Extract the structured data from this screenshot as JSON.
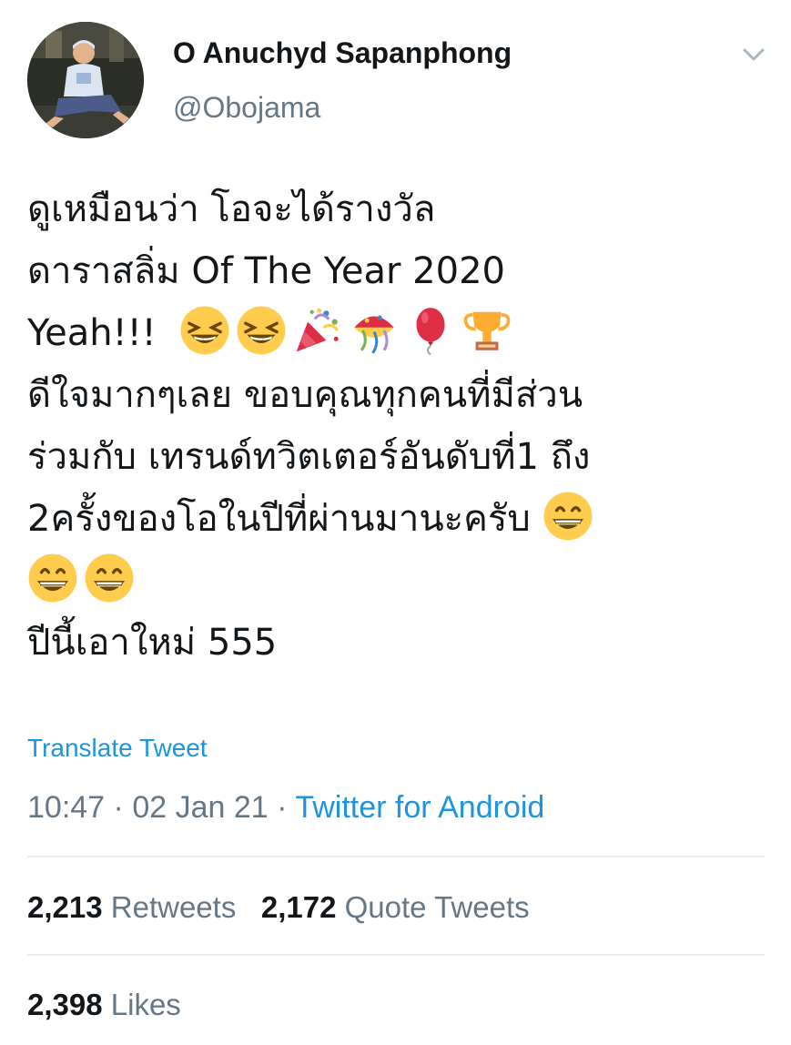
{
  "user": {
    "display_name": "O Anuchyd Sapanphong",
    "handle": "@Obojama"
  },
  "tweet": {
    "line1": "ดูเหมือนว่า โอจะได้รางวัล",
    "line2": "ดาราสลิ่ม Of The Year 2020",
    "line3": "Yeah!!!",
    "line4": "ดีใจมากๆเลย ขอบคุณทุกคนที่มีส่วน",
    "line5": "ร่วมกับ เทรนด์ทวิตเตอร์อันดับที่1 ถึง",
    "line6": "2ครั้งของโอในปีที่ผ่านมานะครับ",
    "line8": "ปีนี้เอาใหม่ 555",
    "emojis_line3": [
      "laughing-face",
      "laughing-face",
      "party-popper",
      "confetti-ball",
      "balloon",
      "trophy"
    ],
    "emojis_line6": [
      "grinning-face"
    ],
    "emojis_line7": [
      "grinning-face",
      "grinning-face"
    ]
  },
  "translate_label": "Translate Tweet",
  "meta": {
    "time": "10:47",
    "separator": "·",
    "date": "02 Jan 21",
    "source": "Twitter for Android"
  },
  "stats": {
    "retweets_count": "2,213",
    "retweets_label": "Retweets",
    "quotes_count": "2,172",
    "quotes_label": "Quote Tweets",
    "likes_count": "2,398",
    "likes_label": "Likes"
  },
  "colors": {
    "link": "#1b95e0",
    "secondary_text": "#657786",
    "primary_text": "#14171a",
    "divider": "#e6ecf0"
  }
}
